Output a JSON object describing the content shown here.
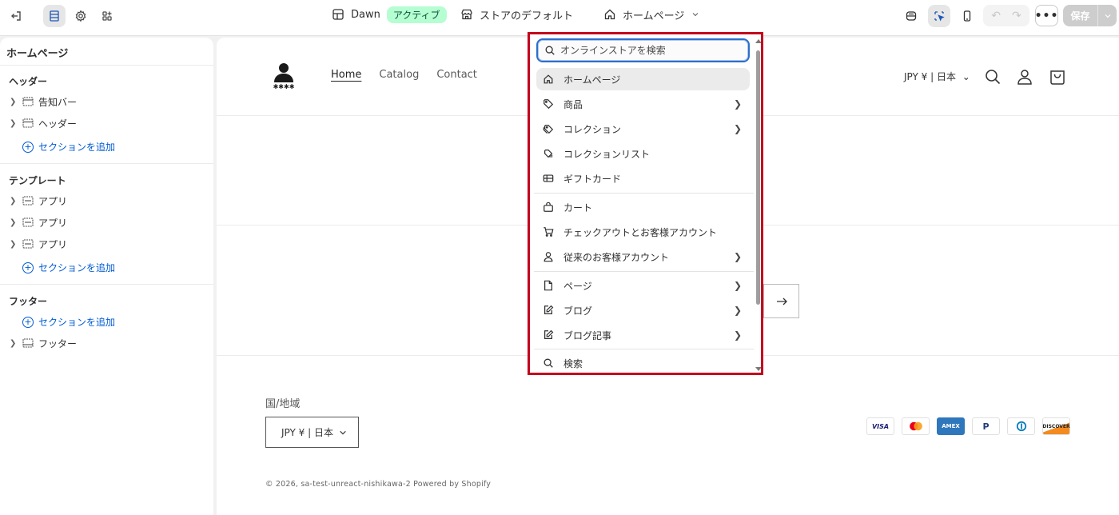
{
  "topbar": {
    "theme_name": "Dawn",
    "theme_status": "アクティブ",
    "store_default": "ストアのデフォルト",
    "page_selector": "ホームページ",
    "save_label": "保存",
    "more_label": "•••"
  },
  "sidebar": {
    "title": "ホームページ",
    "groups": [
      {
        "heading": "ヘッダー",
        "items": [
          "告知バー",
          "ヘッダー"
        ],
        "add_label": "セクションを追加"
      },
      {
        "heading": "テンプレート",
        "items": [
          "アプリ",
          "アプリ",
          "アプリ"
        ],
        "add_label": "セクションを追加"
      },
      {
        "heading": "フッター",
        "add_label": "セクションを追加",
        "items": [
          "フッター"
        ]
      }
    ]
  },
  "preview": {
    "nav": [
      "Home",
      "Catalog",
      "Contact"
    ],
    "currency": "JPY ¥ | 日本",
    "region_label": "国/地域",
    "region_value": "JPY ¥ | 日本",
    "copyright": "© 2026, sa-test-unreact-nishikawa-2 Powered by Shopify",
    "payments": [
      "VISA",
      "Mastercard",
      "AMEX",
      "PayPal",
      "Diners",
      "DISCOVER"
    ]
  },
  "dropdown": {
    "search_placeholder": "オンラインストアを検索",
    "items": [
      {
        "label": "ホームページ",
        "icon": "home-icon",
        "chevron": false,
        "selected": true
      },
      {
        "label": "商品",
        "icon": "tag-icon",
        "chevron": true
      },
      {
        "label": "コレクション",
        "icon": "tags-icon",
        "chevron": true
      },
      {
        "label": "コレクションリスト",
        "icon": "collection-list-icon",
        "chevron": false
      },
      {
        "label": "ギフトカード",
        "icon": "gift-card-icon",
        "chevron": false
      },
      {
        "label": "カート",
        "icon": "bag-icon",
        "chevron": false
      },
      {
        "label": "チェックアウトとお客様アカウント",
        "icon": "cart-icon",
        "chevron": false
      },
      {
        "label": "従来のお客様アカウント",
        "icon": "person-icon",
        "chevron": true
      },
      {
        "label": "ページ",
        "icon": "page-icon",
        "chevron": true
      },
      {
        "label": "ブログ",
        "icon": "edit-icon",
        "chevron": true
      },
      {
        "label": "ブログ記事",
        "icon": "edit-icon",
        "chevron": true
      },
      {
        "label": "検索",
        "icon": "search-icon",
        "chevron": false
      }
    ]
  }
}
